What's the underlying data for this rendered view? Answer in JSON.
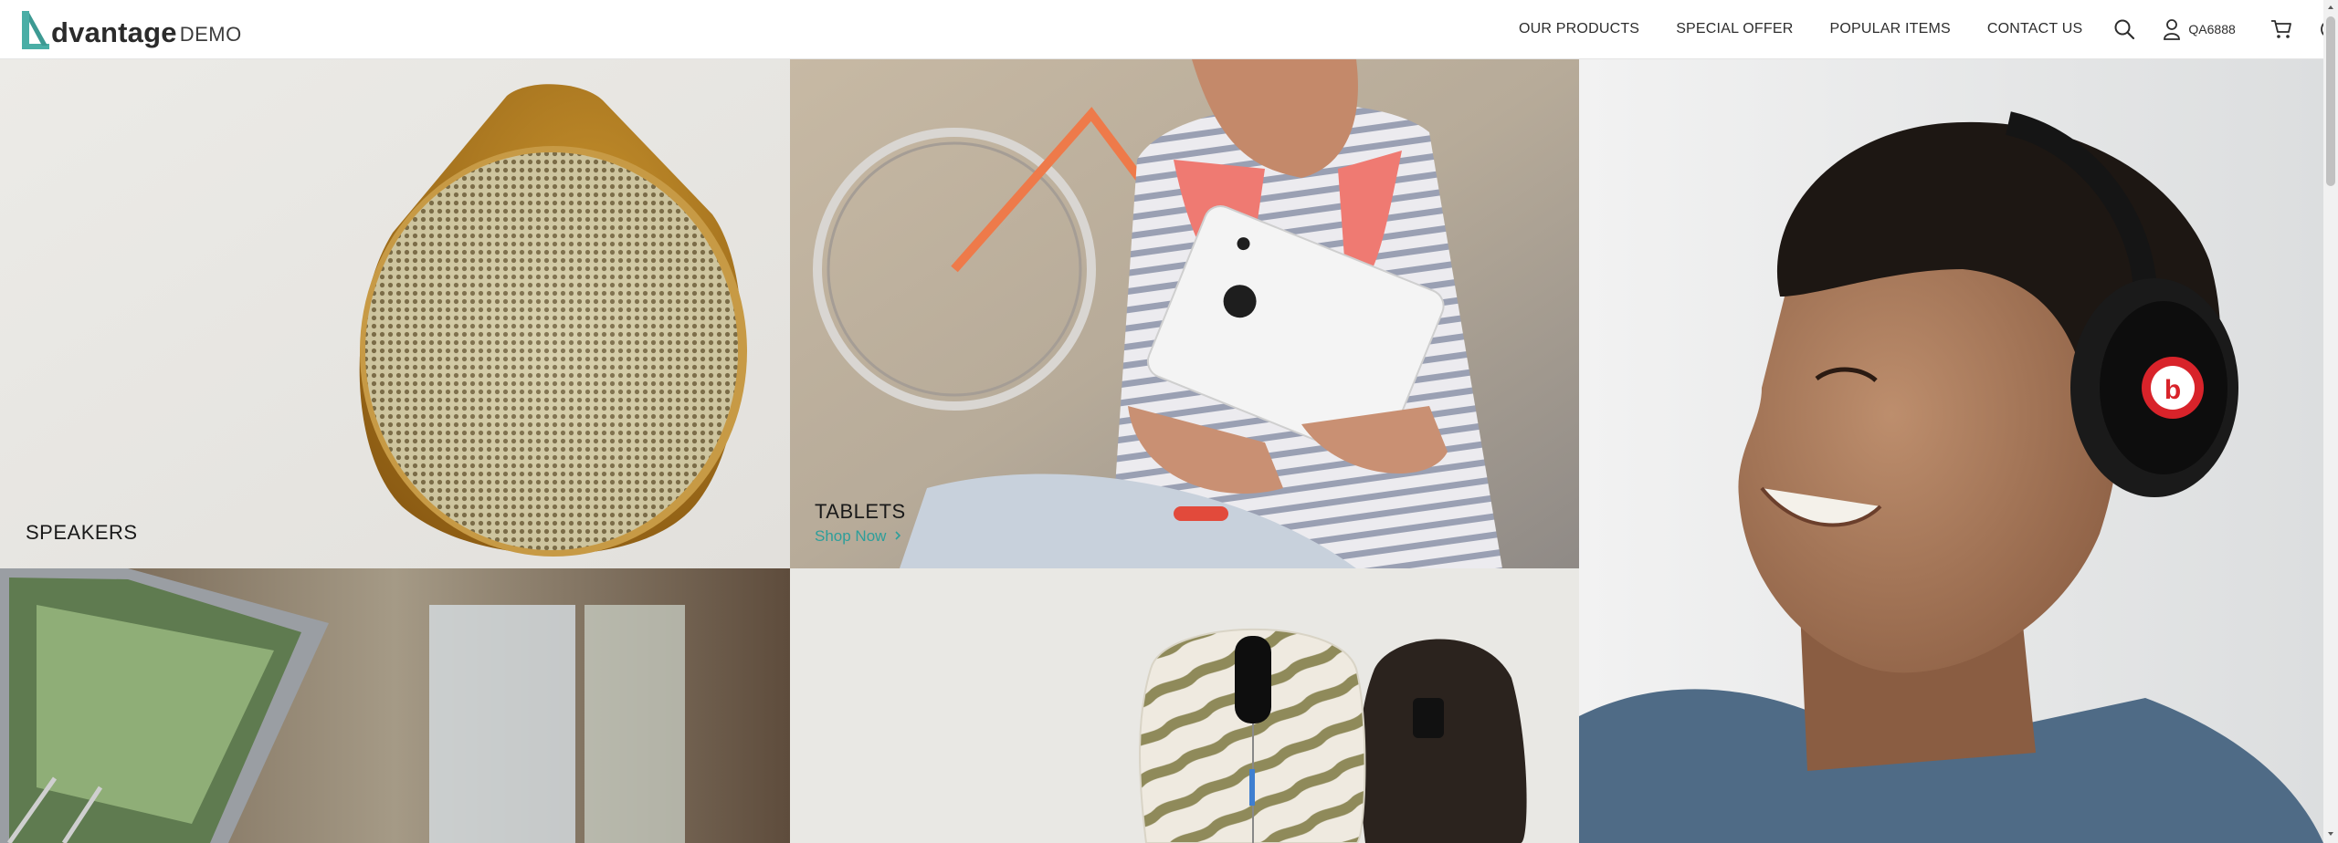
{
  "header": {
    "logo_word": "dvantage",
    "logo_demo": "DEMO",
    "nav": [
      {
        "label": "OUR PRODUCTS"
      },
      {
        "label": "SPECIAL OFFER"
      },
      {
        "label": "POPULAR ITEMS"
      },
      {
        "label": "CONTACT US"
      }
    ],
    "search_icon": "search-icon",
    "user_icon": "user-icon",
    "username": "QA6888",
    "cart_icon": "cart-icon",
    "help_icon": "help-icon"
  },
  "tiles": {
    "speakers": {
      "title": "SPEAKERS"
    },
    "tablets": {
      "title": "TABLETS",
      "shop_link": "Shop Now"
    },
    "headphones": {
      "title": ""
    },
    "laptops": {
      "title": ""
    },
    "mice": {
      "title": ""
    }
  },
  "colors": {
    "accent": "#2d9e9a",
    "logo_mark": "#4aaea6",
    "text": "#2d2d2d"
  }
}
